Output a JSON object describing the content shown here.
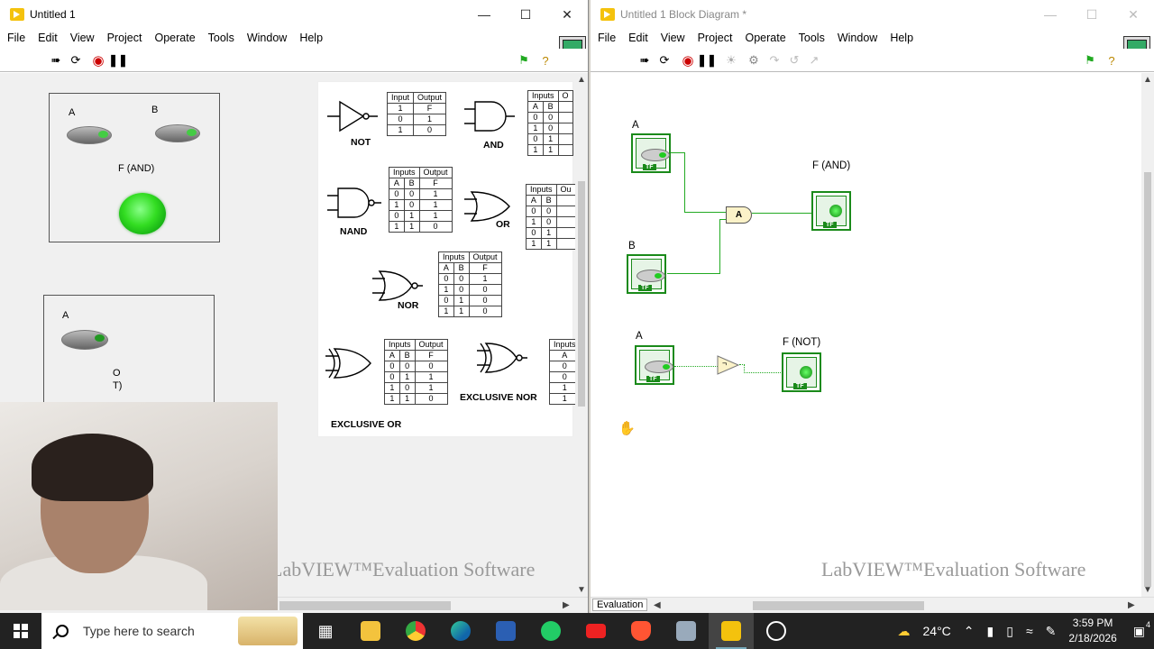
{
  "front_panel": {
    "title": "Untitled 1",
    "menu": [
      "File",
      "Edit",
      "View",
      "Project",
      "Operate",
      "Tools",
      "Window",
      "Help"
    ],
    "and_panel": {
      "label_a": "A",
      "label_b": "B",
      "label_out": "F (AND)"
    },
    "not_panel": {
      "label_a": "A",
      "label_out_1": "O",
      "label_out_2": "T)"
    },
    "watermark": "LabVIEW™Evaluation Software",
    "reference": {
      "not": {
        "name": "NOT",
        "headers": [
          "Input",
          "Output"
        ],
        "rows": [
          [
            "1",
            "F"
          ],
          [
            "0",
            "1"
          ],
          [
            "1",
            "0"
          ]
        ]
      },
      "and": {
        "name": "AND",
        "headers": [
          "Inputs",
          "O"
        ],
        "sub": [
          "A",
          "B"
        ],
        "rows": [
          [
            "0",
            "0"
          ],
          [
            "1",
            "0"
          ],
          [
            "0",
            "1"
          ],
          [
            "1",
            "1"
          ]
        ]
      },
      "nand": {
        "name": "NAND",
        "headers": [
          "Inputs",
          "Output"
        ],
        "sub": [
          "A",
          "B",
          "F"
        ],
        "rows": [
          [
            "0",
            "0",
            "1"
          ],
          [
            "1",
            "0",
            "1"
          ],
          [
            "0",
            "1",
            "1"
          ],
          [
            "1",
            "1",
            "0"
          ]
        ]
      },
      "or": {
        "name": "OR",
        "headers": [
          "Inputs",
          "Ou"
        ],
        "sub": [
          "A",
          "B"
        ],
        "rows": [
          [
            "0",
            "0"
          ],
          [
            "1",
            "0"
          ],
          [
            "0",
            "1"
          ],
          [
            "1",
            "1"
          ]
        ]
      },
      "nor": {
        "name": "NOR",
        "headers": [
          "Inputs",
          "Output"
        ],
        "sub": [
          "A",
          "B",
          "F"
        ],
        "rows": [
          [
            "0",
            "0",
            "1"
          ],
          [
            "1",
            "0",
            "0"
          ],
          [
            "0",
            "1",
            "0"
          ],
          [
            "1",
            "1",
            "0"
          ]
        ]
      },
      "xor": {
        "name": "EXCLUSIVE OR",
        "headers": [
          "Inputs",
          "Output"
        ],
        "sub": [
          "A",
          "B",
          "F"
        ],
        "rows": [
          [
            "0",
            "0",
            "0"
          ],
          [
            "0",
            "1",
            "1"
          ],
          [
            "1",
            "0",
            "1"
          ],
          [
            "1",
            "1",
            "0"
          ]
        ]
      },
      "xnor": {
        "name": "EXCLUSIVE NOR",
        "headers": [
          "Inputs"
        ],
        "sub": [
          "A"
        ],
        "rows": [
          [
            "0"
          ],
          [
            "0"
          ],
          [
            "1"
          ],
          [
            "1"
          ]
        ]
      }
    }
  },
  "block_diagram": {
    "title": "Untitled 1 Block Diagram *",
    "menu": [
      "File",
      "Edit",
      "View",
      "Project",
      "Operate",
      "Tools",
      "Window",
      "Help"
    ],
    "labels": {
      "a1": "A",
      "b": "B",
      "and_out": "F (AND)",
      "a2": "A",
      "not_out": "F (NOT)"
    },
    "and_symbol": "A",
    "not_symbol": "¬",
    "tf": "TF",
    "watermark": "LabVIEW™Evaluation Software",
    "status_tab": "Evaluation"
  },
  "taskbar": {
    "search_placeholder": "Type here to search",
    "weather": "24°C",
    "time": "3:59 PM",
    "date": "2/18/2026",
    "notifications": "4"
  }
}
